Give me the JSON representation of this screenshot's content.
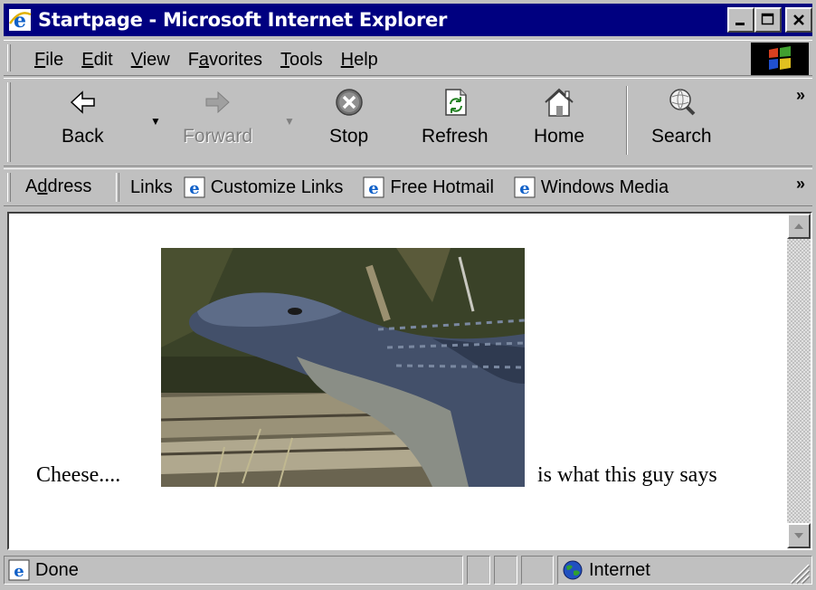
{
  "window": {
    "title": "Startpage - Microsoft Internet Explorer",
    "controls": {
      "minimize": "_",
      "maximize": "□",
      "close": "×"
    }
  },
  "menu": [
    {
      "pre": "",
      "u": "F",
      "post": "ile"
    },
    {
      "pre": "",
      "u": "E",
      "post": "dit"
    },
    {
      "pre": "",
      "u": "V",
      "post": "iew"
    },
    {
      "pre": "F",
      "u": "a",
      "post": "vorites"
    },
    {
      "pre": "",
      "u": "T",
      "post": "ools"
    },
    {
      "pre": "",
      "u": "H",
      "post": "elp"
    }
  ],
  "toolbar": {
    "back": "Back",
    "forward": "Forward",
    "stop": "Stop",
    "refresh": "Refresh",
    "home": "Home",
    "search": "Search",
    "more": "»"
  },
  "address_bar": {
    "address_pre": "A",
    "address_u": "d",
    "address_post": "dress",
    "links_label": "Links",
    "links": [
      "Customize Links",
      "Free Hotmail",
      "Windows Media"
    ],
    "more": "»"
  },
  "page": {
    "text_before": "Cheese....",
    "text_after": "is what this guy says",
    "image": "alligator-photo"
  },
  "status": {
    "text": "Done",
    "zone": "Internet"
  },
  "colors": {
    "titlebar": "#000080",
    "chrome": "#c0c0c0",
    "content_bg": "#ffffff"
  }
}
